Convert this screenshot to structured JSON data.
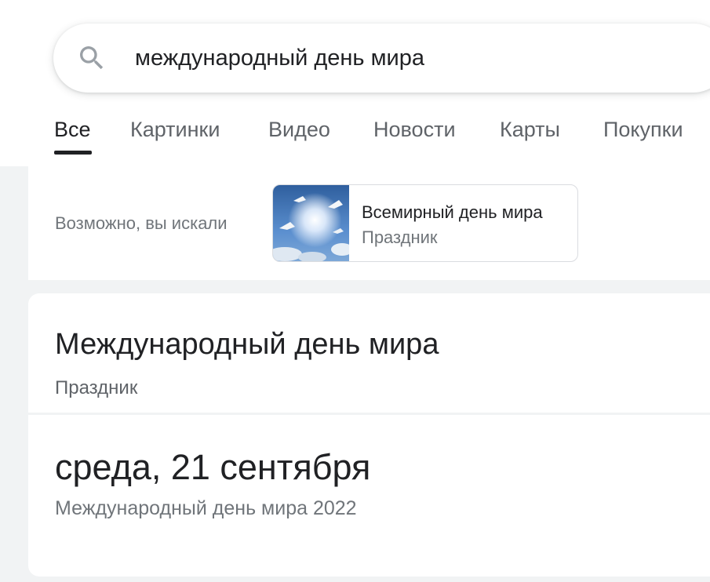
{
  "search": {
    "query": "международный день мира"
  },
  "tabs": [
    {
      "label": "Все",
      "active": true
    },
    {
      "label": "Картинки"
    },
    {
      "label": "Видео"
    },
    {
      "label": "Новости"
    },
    {
      "label": "Карты"
    },
    {
      "label": "Покупки"
    }
  ],
  "suggestion": {
    "prompt": "Возможно, вы искали",
    "title": "Всемирный день мира",
    "subtitle": "Праздник",
    "thumb_icon": "doves-sky-image"
  },
  "knowledge_panel": {
    "title": "Международный день мира",
    "type": "Праздник"
  },
  "date_answer": {
    "date": "среда, 21 сентября",
    "caption": "Международный день мира 2022"
  },
  "colors": {
    "page_bg": "#f1f3f4",
    "text_primary": "#202124",
    "text_secondary": "#70757a",
    "tab_inactive": "#5f6368"
  }
}
